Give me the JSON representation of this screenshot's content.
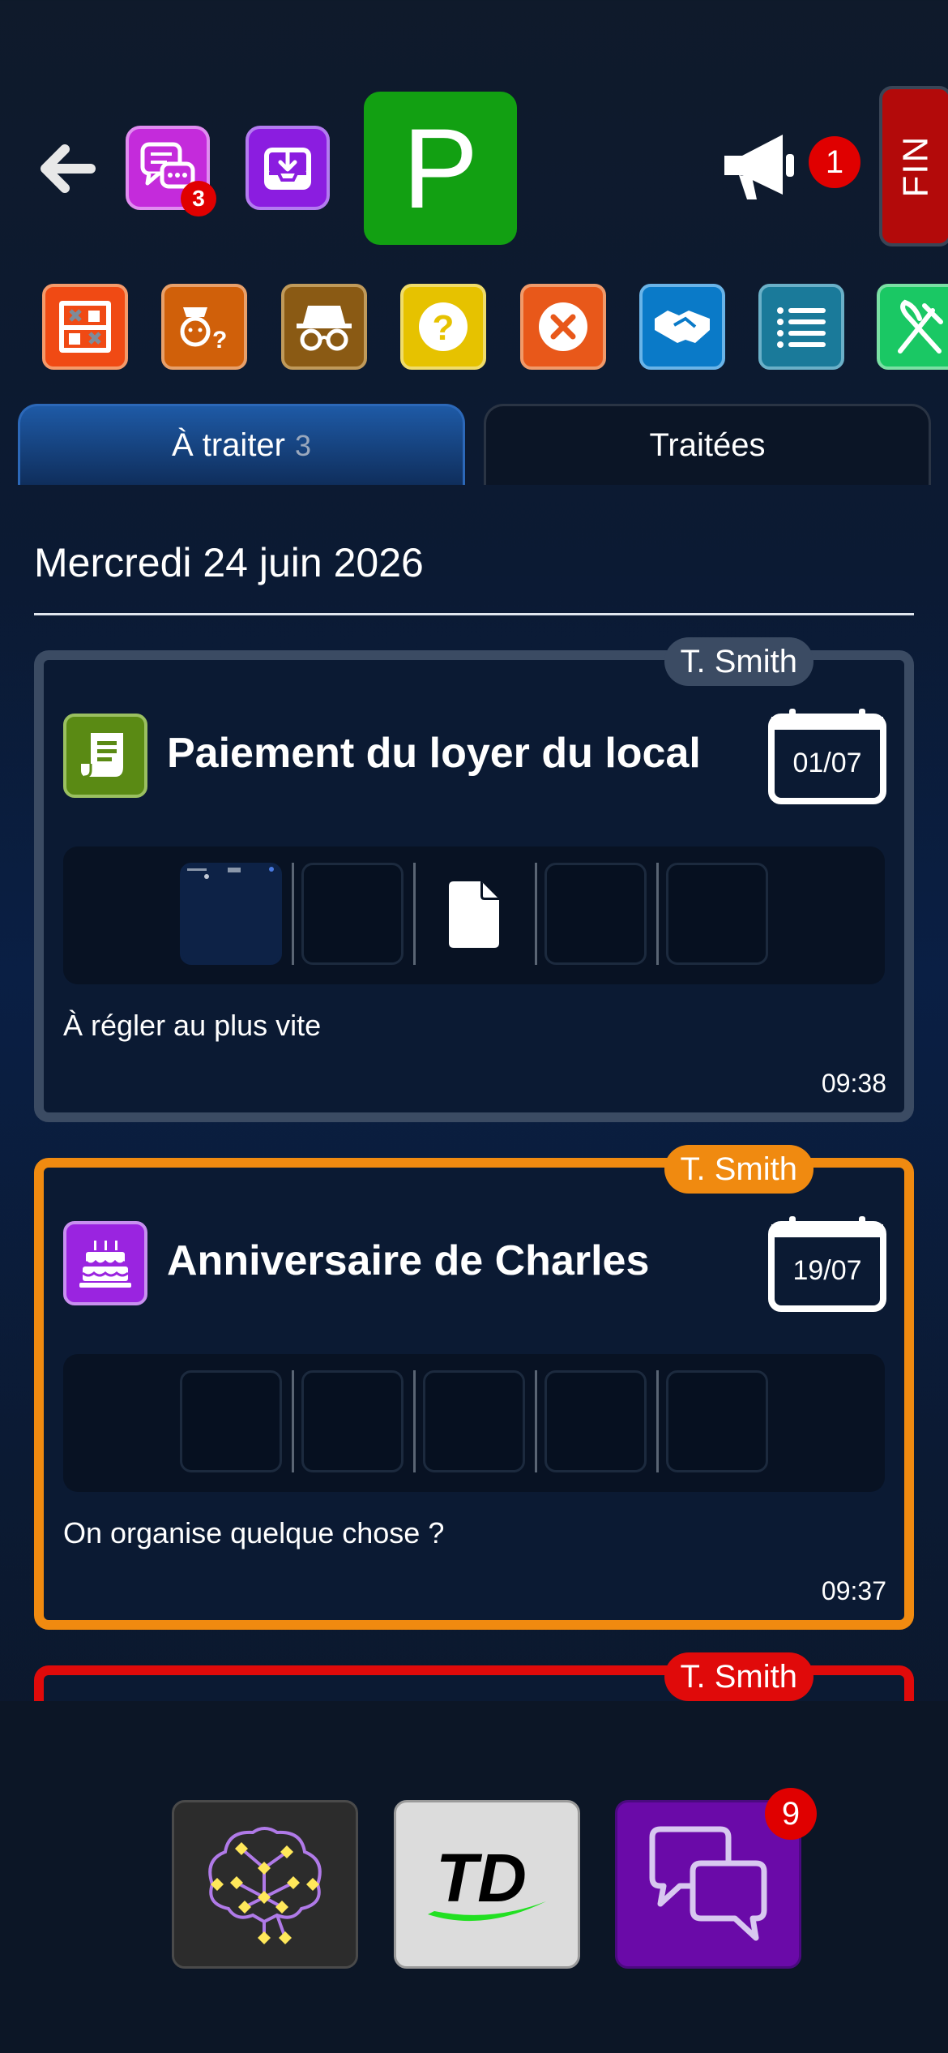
{
  "header": {
    "chat_badge": "3",
    "parking_label": "P",
    "announce_badge": "1",
    "end_label": "FIN"
  },
  "tabs": [
    {
      "label": "À traiter",
      "count": "3"
    },
    {
      "label": "Traitées"
    }
  ],
  "date_heading": "Mercredi 24 juin 2026",
  "cards": [
    {
      "owner": "T. Smith",
      "title": "Paiement du loyer du local",
      "due_date": "01/07",
      "description": "À régler au plus vite",
      "time": "09:38",
      "border_color": "#3b4b63",
      "category_icon": "receipt-icon"
    },
    {
      "owner": "T. Smith",
      "title": "Anniversaire de Charles",
      "due_date": "19/07",
      "description": "On organise quelque chose ?",
      "time": "09:37",
      "border_color": "#f08a10",
      "category_icon": "birthday-cake-icon"
    },
    {
      "owner": "T. Smith",
      "border_color": "#e00a0a"
    }
  ],
  "tool_icons": [
    "shelf-broken-icon",
    "person-question-icon",
    "incognito-icon",
    "help-icon",
    "cancel-icon",
    "handshake-icon",
    "list-icon",
    "cutlery-icon"
  ],
  "bottom": {
    "messages_badge": "9"
  }
}
